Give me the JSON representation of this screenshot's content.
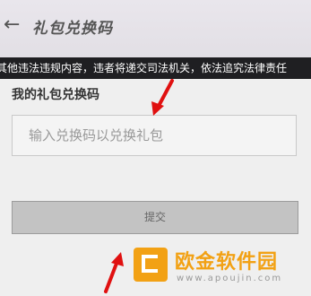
{
  "header": {
    "back_icon": "arrow-left-icon",
    "title": "礼包兑换码"
  },
  "notice": {
    "text": "其他违法违规内容，违者将递交司法机关，依法追究法律责任"
  },
  "redeem": {
    "section_label": "我的礼包兑换码",
    "input_placeholder": "输入兑换码以兑换礼包",
    "submit_label": "提交"
  },
  "annotations": {
    "arrow_color": "#e01010"
  },
  "watermark": {
    "name": "欧金软件园",
    "url": "www.apoujin.com",
    "brand_color": "#f2a114"
  }
}
